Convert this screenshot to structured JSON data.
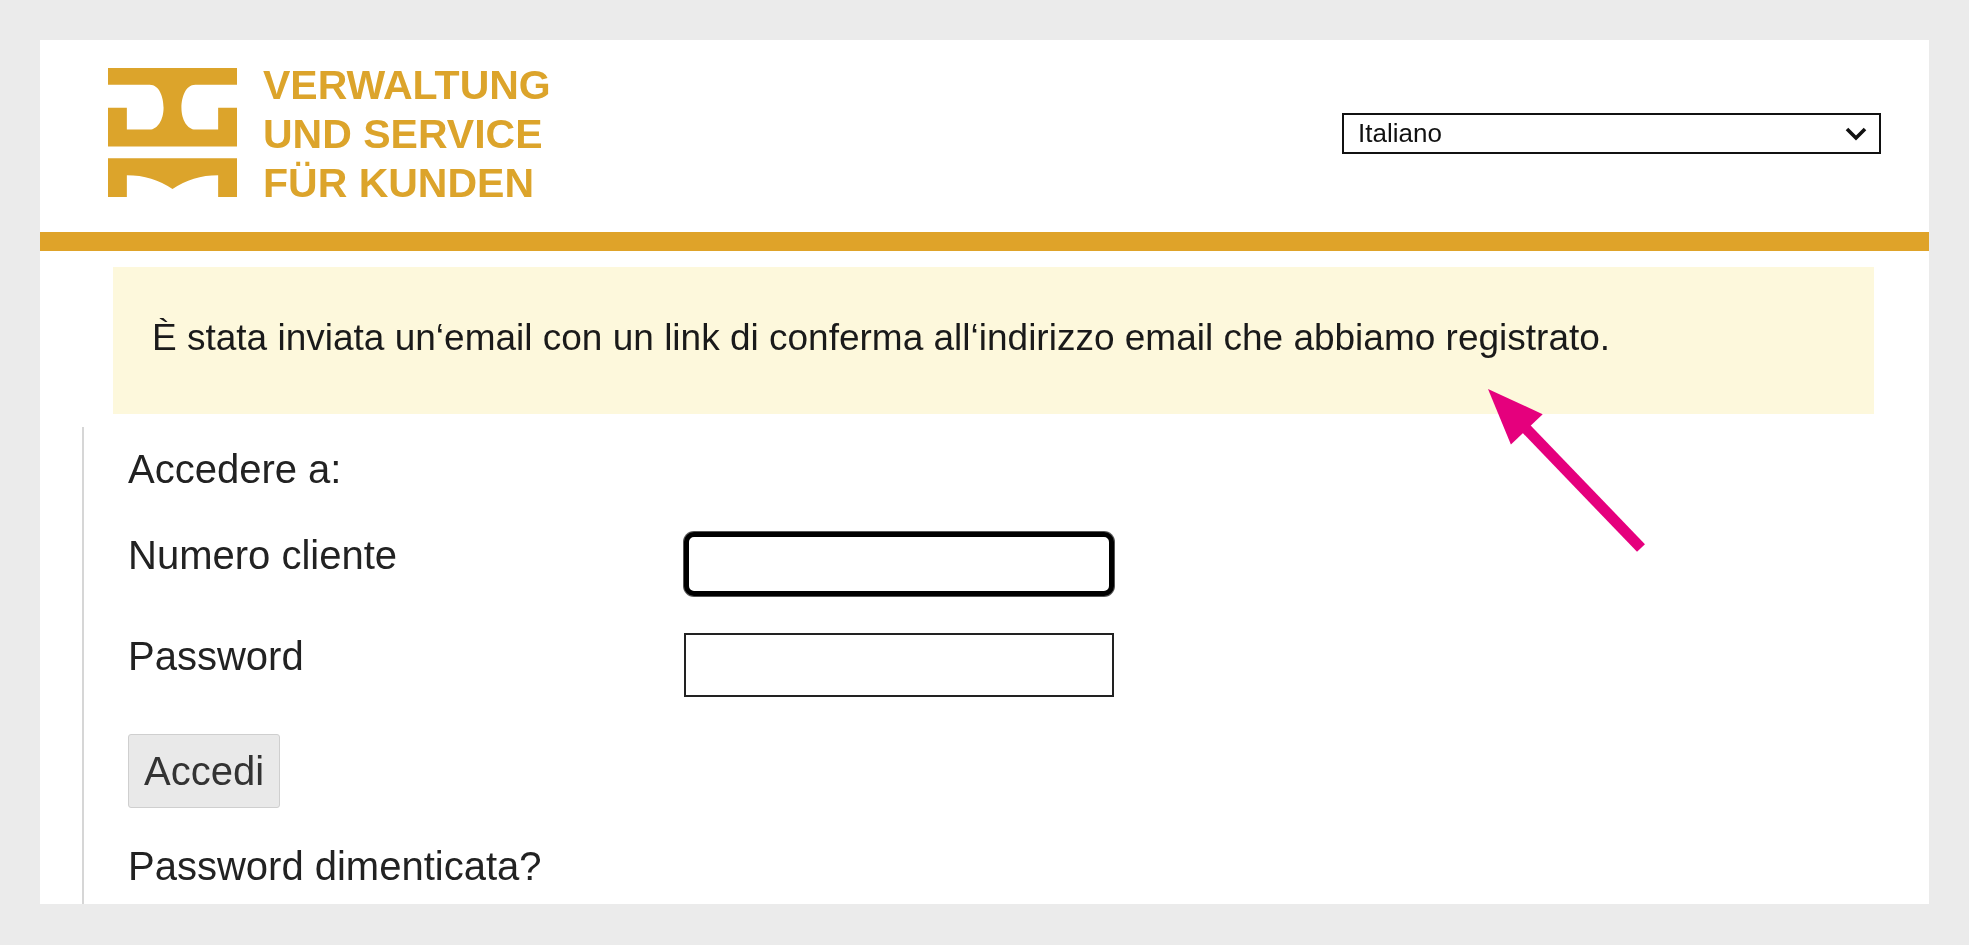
{
  "header": {
    "logo_lines": [
      "VERWALTUNG",
      "UND SERVICE",
      "FÜR KUNDEN"
    ],
    "language_select": {
      "value": "Italiano"
    }
  },
  "notice": {
    "text": "È stata inviata un‘email con un link di conferma all‘indirizzo email che abbiamo registrato."
  },
  "login": {
    "heading": "Accedere a:",
    "fields": [
      {
        "label": "Numero cliente",
        "focused": true
      },
      {
        "label": "Password",
        "focused": false
      }
    ],
    "submit_button": "Accedi",
    "forgot_link": "Password dimenticata?"
  }
}
